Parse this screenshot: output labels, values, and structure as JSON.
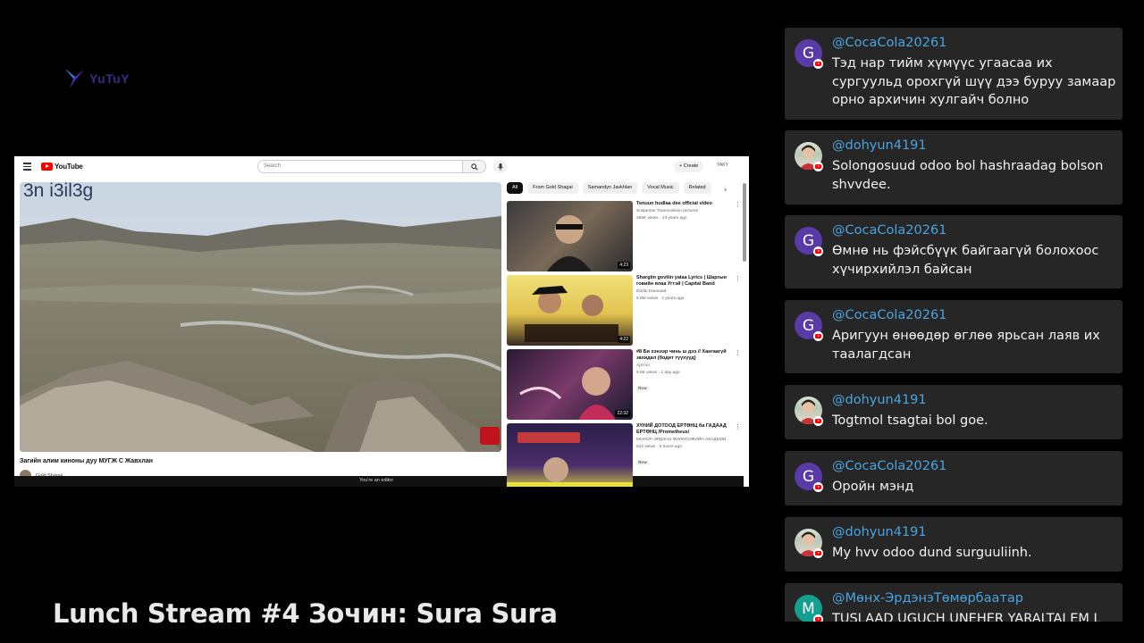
{
  "logo": {
    "text": "YuTuY"
  },
  "browser": {
    "search_placeholder": "Search",
    "create_label": "Create",
    "avatar_text": "YAKY",
    "video_overlay_text": "3n i3il3g",
    "video_title": "Загийн алим киноны дуу МУГЖ С Жавхлан",
    "channel_name": "Gold Shagai",
    "editor_note": "You're an editor",
    "chips": [
      "All",
      "From Gold Shagai",
      "Samandyn Javkhlan",
      "Vocal Music",
      "Related"
    ],
    "recommendations": [
      {
        "title": "Tenuun hudlaa dee official video",
        "channel": "Suspense Transmission pictures",
        "meta": "495K views · 13 years ago",
        "duration": "4:23",
        "badge": ""
      },
      {
        "title": "Shargiin govliin yalaa Lyrics | Шаргын говийн ялаа Угтэй | Capital Band",
        "channel": "Dorlai Daunaad",
        "meta": "6.8M views · 4 years ago",
        "duration": "4:22",
        "badge": ""
      },
      {
        "title": "#8 Би хэнээр чинь ш дээ // Хангаагүй захидал (бодит түүхүүд)",
        "channel": "Артгэо",
        "meta": "5.6K views · 1 day ago",
        "duration": "22:32",
        "badge": "New"
      },
      {
        "title": "ХҮНИЙ ДОТООД ЕРТӨНЦ ба ГАДААД ЕРТӨНЦ /Prometheus/",
        "channel": "МОЛОР-ЭРДЭНЭ ФИЛОСОФИЙН АКАДЕМИ",
        "meta": "822 views · 5 hours ago",
        "duration": "",
        "badge": "New"
      }
    ]
  },
  "stream": {
    "title": "Lunch Stream #4 Зочин: Sura Sura"
  },
  "chat": {
    "messages": [
      {
        "user": "@CocaCola20261",
        "avatar_letter": "G",
        "avatar_style": "purple",
        "text": "Тэд нар тийм хүмүүс угаасаа их сургуульд орохгүй шүү дээ буруу замаар орно архичин хулгайч болно"
      },
      {
        "user": "@dohyun4191",
        "avatar_letter": "",
        "avatar_style": "photo",
        "text": "Solongosuud odoo bol hashraadag bolson shvvdee."
      },
      {
        "user": "@CocaCola20261",
        "avatar_letter": "G",
        "avatar_style": "purple",
        "text": "Өмнө нь фэйсбүүк байгаагүй болохоос хүчирхийлэл байсан"
      },
      {
        "user": "@CocaCola20261",
        "avatar_letter": "G",
        "avatar_style": "purple",
        "text": "Аригуун өнөөдөр өглөө ярьсан лаяв их таалагдсан"
      },
      {
        "user": "@dohyun4191",
        "avatar_letter": "",
        "avatar_style": "photo",
        "text": "Togtmol tsagtai bol goe."
      },
      {
        "user": "@CocaCola20261",
        "avatar_letter": "G",
        "avatar_style": "purple",
        "text": "Оройн мэнд"
      },
      {
        "user": "@dohyun4191",
        "avatar_letter": "",
        "avatar_style": "photo",
        "text": "My hvv odoo dund surguuliinh."
      },
      {
        "user": "@Мөнх-ЭрдэнэТөмөрбаатар",
        "avatar_letter": "M",
        "avatar_style": "teal",
        "text": "TUSLAAD UGUCH UNEHER YARALTAI EM L"
      }
    ]
  },
  "colors": {
    "chat_username": "#4aa3df",
    "chat_bubble": "#262626",
    "youtube_red": "#ff0000"
  },
  "icons": [
    "hamburger-menu-icon",
    "youtube-logo-icon",
    "search-icon",
    "microphone-icon",
    "plus-icon",
    "chevron-right-icon",
    "more-vertical-icon",
    "youtube-badge-icon"
  ]
}
